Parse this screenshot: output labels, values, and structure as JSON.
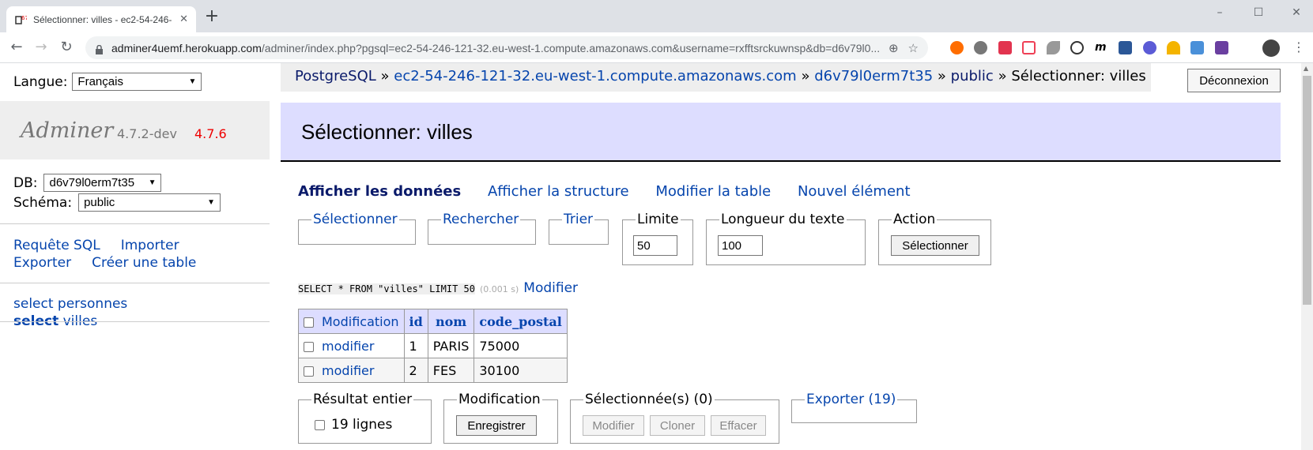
{
  "browser": {
    "tab_title": "Sélectionner: villes - ec2-54-246-",
    "tab_close": "✕",
    "new_tab": "+",
    "url_host": "adminer4uemf.herokuapp.com",
    "url_rest": "/adminer/index.php?pgsql=ec2-54-246-121-32.eu-west-1.compute.amazonaws.com&username=rxfftsrckuwnsp&db=d6v79l0..."
  },
  "sidebar": {
    "lang_label": "Langue:",
    "lang_value": "Français",
    "app_name": "Adminer",
    "version": "4.7.2-dev",
    "new_version": "4.7.6",
    "db_label": "DB:",
    "db_value": "d6v79l0erm7t35",
    "schema_label": "Schéma:",
    "schema_value": "public",
    "links": {
      "sql": "Requête SQL",
      "import": "Importer",
      "export": "Exporter",
      "create_table": "Créer une table"
    },
    "tables": [
      {
        "action": "select",
        "name": "personnes"
      },
      {
        "action": "select",
        "name": "villes"
      }
    ]
  },
  "breadcrumb": {
    "driver": "PostgreSQL",
    "server": "ec2-54-246-121-32.eu-west-1.compute.amazonaws.com",
    "database": "d6v79l0erm7t35",
    "schema": "public",
    "current": "Sélectionner: villes",
    "sep": "»"
  },
  "logout_label": "Déconnexion",
  "heading": "Sélectionner: villes",
  "tabs": {
    "data": "Afficher les données",
    "structure": "Afficher la structure",
    "alter": "Modifier la table",
    "new_item": "Nouvel élément"
  },
  "filters": {
    "select": "Sélectionner",
    "search": "Rechercher",
    "sort": "Trier",
    "limit_label": "Limite",
    "limit_value": "50",
    "text_length_label": "Longueur du texte",
    "text_length_value": "100",
    "action_label": "Action",
    "action_button": "Sélectionner"
  },
  "query": {
    "sql": "SELECT * FROM \"villes\" LIMIT 50",
    "time": "(0.001 s)",
    "edit": "Modifier"
  },
  "table": {
    "headers": [
      "Modification",
      "id",
      "nom",
      "code_postal"
    ],
    "rows": [
      {
        "edit": "modifier",
        "id": "1",
        "nom": "PARIS",
        "code_postal": "75000"
      },
      {
        "edit": "modifier",
        "id": "2",
        "nom": "FES",
        "code_postal": "30100"
      }
    ]
  },
  "bottom": {
    "whole_result_label": "Résultat entier",
    "rows_count": "19 lignes",
    "modification_label": "Modification",
    "save_button": "Enregistrer",
    "selected_label": "Sélectionnée(s) (0)",
    "modify_button": "Modifier",
    "clone_button": "Cloner",
    "delete_button": "Effacer",
    "export_label": "Exporter (19)"
  }
}
